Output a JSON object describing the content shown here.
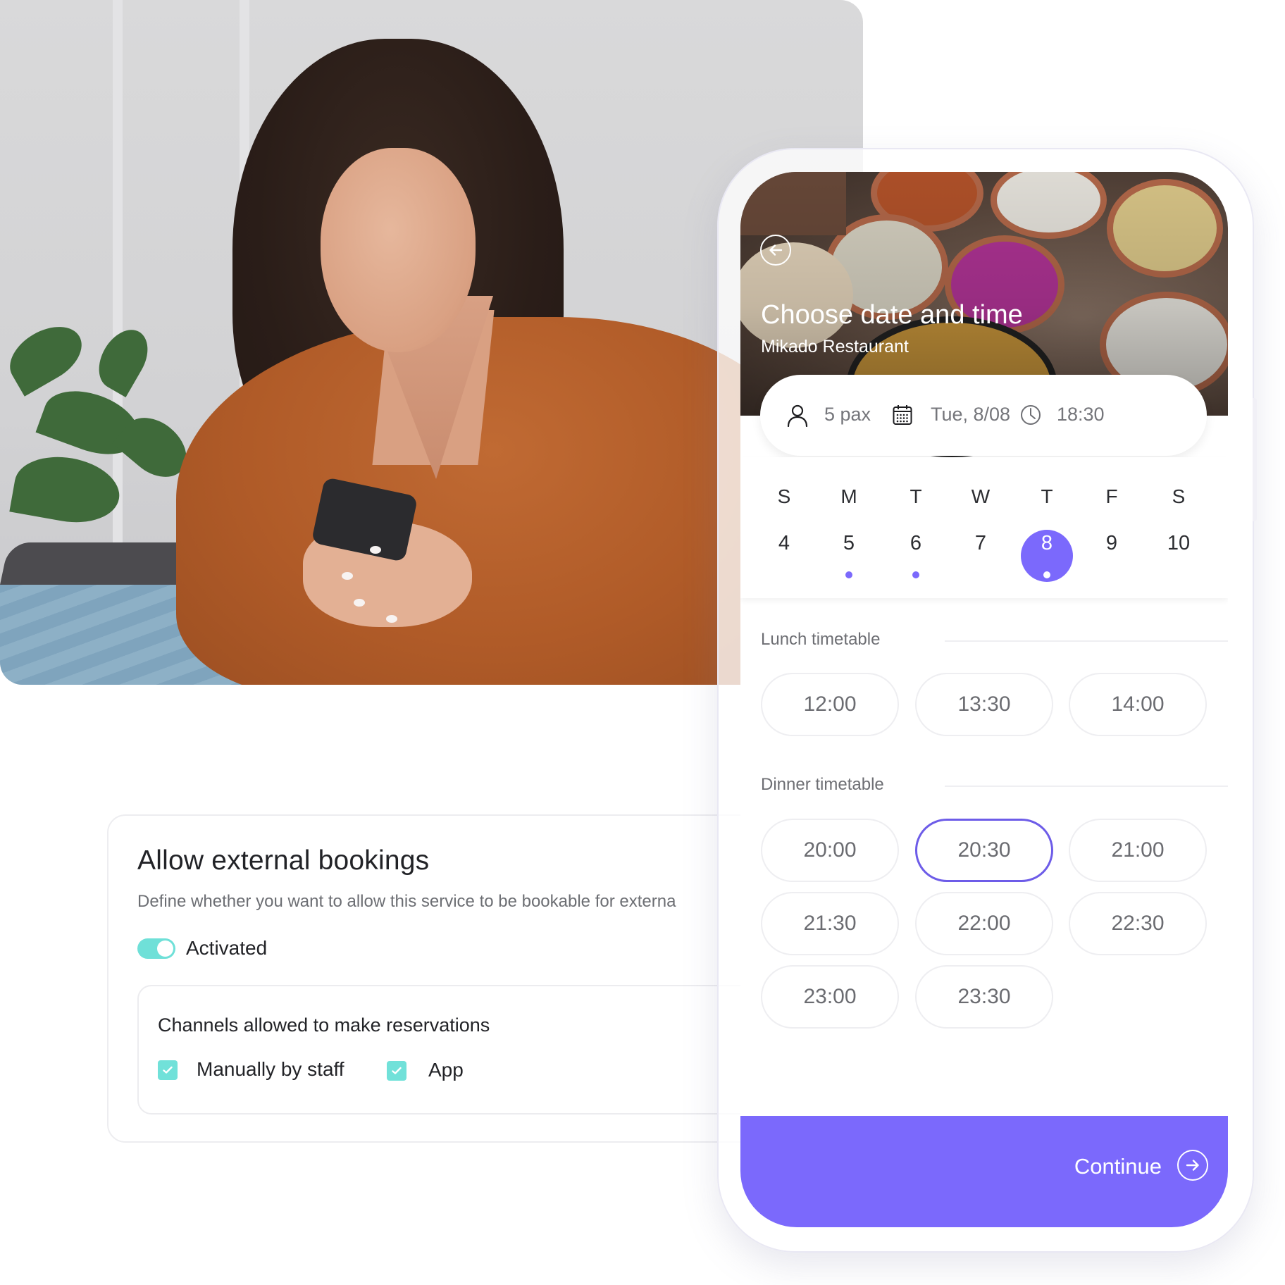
{
  "settings_card": {
    "title": "Allow external bookings",
    "description": "Define whether you want to allow this service to be bookable for externa",
    "toggle": {
      "label": "Activated",
      "on": true,
      "color": "#6fe0d8"
    },
    "channels": {
      "title": "Channels allowed to make reservations",
      "options": [
        {
          "label": "Manually by staff",
          "checked": true
        },
        {
          "label": "App",
          "checked": true
        }
      ]
    }
  },
  "phone": {
    "header": {
      "back_icon": "arrow-left-circle-icon",
      "title": "Choose date and time",
      "subtitle": "Mikado Restaurant"
    },
    "summary": {
      "guests": {
        "icon": "person-icon",
        "value": "5 pax"
      },
      "date": {
        "icon": "calendar-icon",
        "value": "Tue, 8/08"
      },
      "time": {
        "icon": "clock-icon",
        "value": "18:30"
      }
    },
    "calendar": {
      "weekdays": [
        "S",
        "M",
        "T",
        "W",
        "T",
        "F",
        "S"
      ],
      "days": [
        {
          "num": "4",
          "has_availability": false,
          "selected": false
        },
        {
          "num": "5",
          "has_availability": true,
          "selected": false
        },
        {
          "num": "6",
          "has_availability": true,
          "selected": false
        },
        {
          "num": "7",
          "has_availability": false,
          "selected": false
        },
        {
          "num": "8",
          "has_availability": true,
          "selected": true
        },
        {
          "num": "9",
          "has_availability": false,
          "selected": false
        },
        {
          "num": "10",
          "has_availability": false,
          "selected": false
        }
      ]
    },
    "lunch": {
      "label": "Lunch timetable",
      "slots": [
        "12:00",
        "13:30",
        "14:00"
      ]
    },
    "dinner": {
      "label": "Dinner timetable",
      "slots": [
        "20:00",
        "20:30",
        "21:00",
        "21:30",
        "22:00",
        "22:30",
        "23:00",
        "23:30"
      ],
      "selected": "20:30"
    },
    "continue": {
      "label": "Continue",
      "icon": "arrow-right-circle-icon"
    }
  },
  "colors": {
    "accent": "#7b69fc",
    "selected_border": "#6d5ce8",
    "teal": "#6fe0d8"
  }
}
